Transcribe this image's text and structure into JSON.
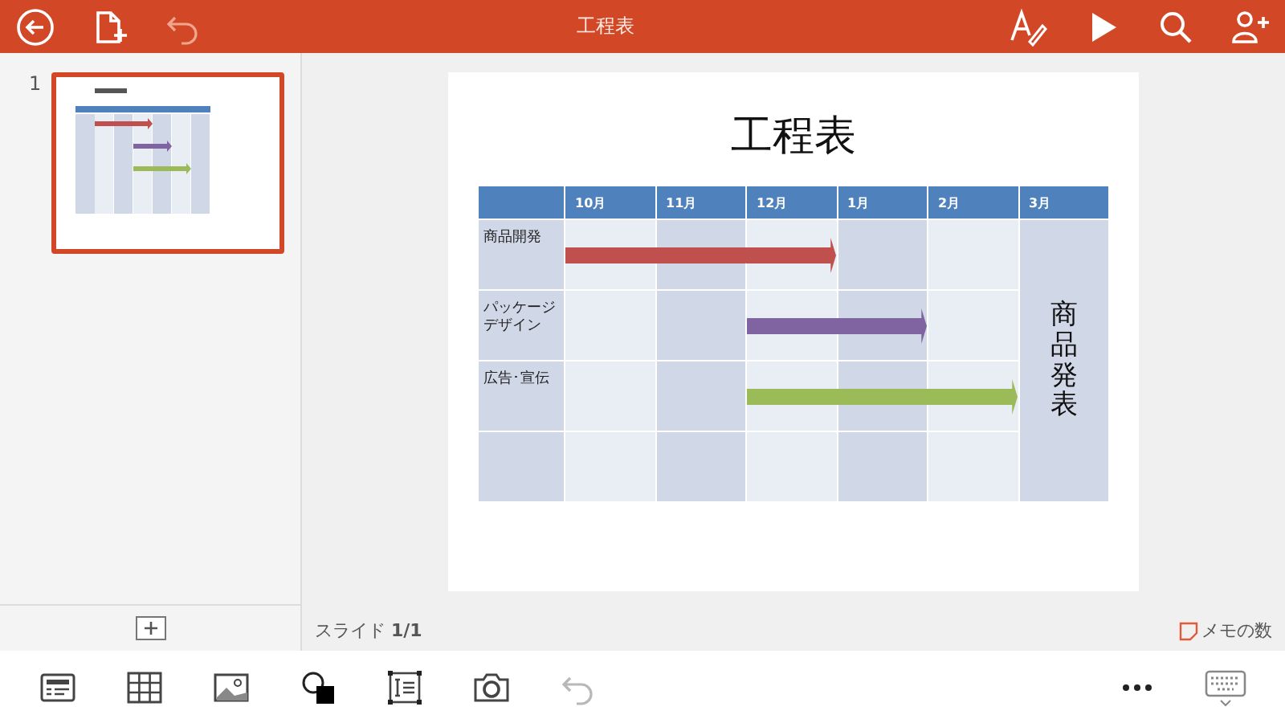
{
  "top_bar": {
    "title": "工程表",
    "undo": {
      "disabled": true
    }
  },
  "slide_panel": {
    "slides": [
      {
        "number": "1",
        "selected": true
      }
    ]
  },
  "slide": {
    "title": "工程表",
    "table": {
      "columns": [
        "10月",
        "11月",
        "12月",
        "1月",
        "2月",
        "3月"
      ],
      "rows": [
        {
          "label": "商品開発",
          "arrow": {
            "color": "#c0504d",
            "months_covered": [
              true,
              true,
              true,
              false,
              false
            ]
          }
        },
        {
          "label": "パッケージデザイン",
          "arrow": {
            "color": "#8064a2",
            "months_covered": [
              false,
              false,
              true,
              true,
              false
            ]
          }
        },
        {
          "label": "広告･宣伝",
          "arrow": {
            "color": "#9bbb59",
            "months_covered": [
              false,
              false,
              true,
              true,
              true
            ]
          }
        },
        {}
      ],
      "last_column_text": "商品発表"
    }
  },
  "status_bar": {
    "slide_count": "スライド **1/1**",
    "notes": "メモの数"
  },
  "bottom_toolbar": {
    "undo": {
      "disabled": true
    }
  }
}
